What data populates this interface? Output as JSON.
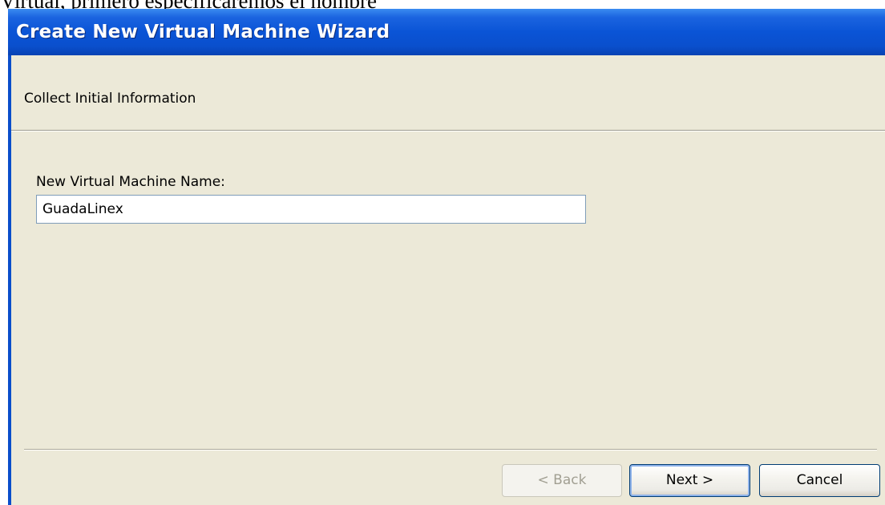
{
  "document": {
    "text": "Virtual, primero especificaremos el nombre"
  },
  "window": {
    "title": "Create New Virtual Machine Wizard"
  },
  "header": {
    "title": "Collect Initial Information"
  },
  "form": {
    "name_label": "New Virtual Machine Name:",
    "name_value": "GuadaLinex"
  },
  "buttons": {
    "back_label": "< Back",
    "back_enabled": false,
    "next_label": "Next >",
    "cancel_label": "Cancel"
  },
  "colors": {
    "titlebar": "#0a54d6",
    "dialog_background": "#ece9d8",
    "input_border": "#7f9db9",
    "button_border": "#003c74"
  }
}
